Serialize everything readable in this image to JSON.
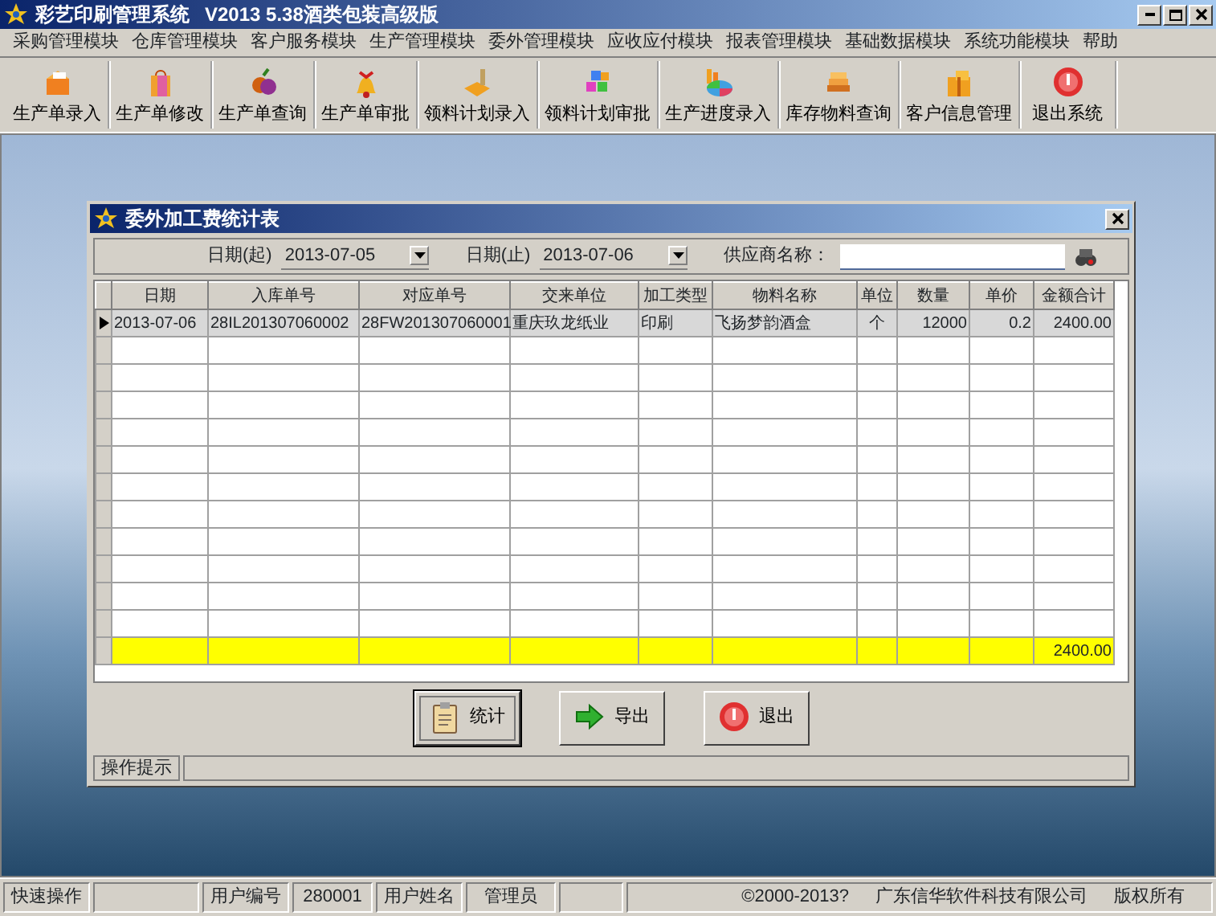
{
  "window": {
    "title": "彩艺印刷管理系统",
    "version": "V2013 5.38酒类包装高级版"
  },
  "menu": [
    "采购管理模块",
    "仓库管理模块",
    "客户服务模块",
    "生产管理模块",
    "委外管理模块",
    "应收应付模块",
    "报表管理模块",
    "基础数据模块",
    "系统功能模块",
    "帮助"
  ],
  "toolbar": [
    "生产单录入",
    "生产单修改",
    "生产单查询",
    "生产单审批",
    "领料计划录入",
    "领料计划审批",
    "生产进度录入",
    "库存物料查询",
    "客户信息管理",
    "退出系统"
  ],
  "child_window": {
    "title": "委外加工费统计表",
    "filters": {
      "date_from_label": "日期(起)",
      "date_from": "2013-07-05",
      "date_to_label": "日期(止)",
      "date_to": "2013-07-06",
      "supplier_label": "供应商名称："
    },
    "table": {
      "columns": [
        "日期",
        "入库单号",
        "对应单号",
        "交来单位",
        "加工类型",
        "物料名称",
        "单位",
        "数量",
        "单价",
        "金额合计"
      ],
      "rows": [
        {
          "selected": true,
          "cells": [
            "2013-07-06",
            "28IL201307060002",
            "28FW201307060001",
            "重庆玖龙纸业",
            "印刷",
            "飞扬梦韵酒盒",
            "个",
            "12000",
            "0.2",
            "2400.00"
          ]
        }
      ],
      "total": "2400.00"
    },
    "buttons": [
      {
        "label": "统计",
        "focused": true
      },
      {
        "label": "导出",
        "focused": false
      },
      {
        "label": "退出",
        "focused": false
      }
    ],
    "hint_label": "操作提示"
  },
  "status_bar": {
    "quick_label": "快速操作",
    "user_id_label": "用户编号",
    "user_id": "280001",
    "user_name_label": "用户姓名",
    "user_name": "管理员",
    "copyright": "©2000-2013?",
    "company": "广东信华软件科技有限公司",
    "rights": "版权所有"
  }
}
